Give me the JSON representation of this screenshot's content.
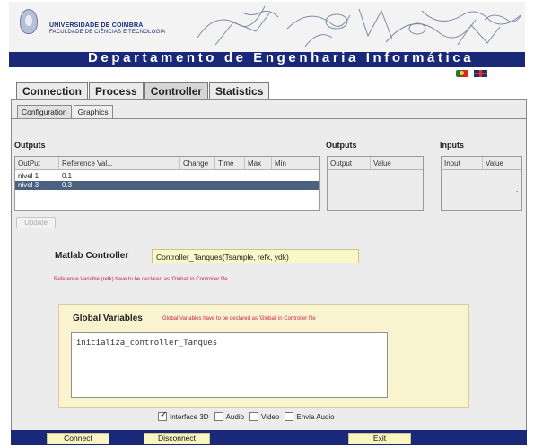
{
  "banner": {
    "university": "UNIVERSIDADE DE COIMBRA",
    "faculty": "FACULDADE DE CIÊNCIAS E TECNOLOGIA",
    "department": "Departamento de Engenharia Informática"
  },
  "main_tabs": [
    "Connection",
    "Process",
    "Controller",
    "Statistics"
  ],
  "sub_tabs": [
    "Configuration",
    "Graphics"
  ],
  "outputs_left": {
    "label": "Outputs",
    "columns": [
      "OutPut",
      "Reference Val...",
      "Change",
      "Time",
      "Max",
      "Min"
    ],
    "rows": [
      {
        "output": "nivel 1",
        "reference": "0.1",
        "selected": false
      },
      {
        "output": "nivel 3",
        "reference": "0.3",
        "selected": true
      }
    ]
  },
  "outputs_right": {
    "label": "Outputs",
    "columns": [
      "Output",
      "Value"
    ]
  },
  "inputs": {
    "label": "Inputs",
    "columns": [
      "Input",
      "Value"
    ],
    "dot": "."
  },
  "update_button": "Update",
  "matlab": {
    "label": "Matlab Controller",
    "value": "Controller_Tanques(Tsample, refk, ydk)",
    "note": "Reference Variable (refk) have to be declared as 'Global' in Controller file"
  },
  "global_vars": {
    "label": "Global Variables",
    "note": "Global Variables have to be declared as 'Global' in Controller file",
    "value": "inicializa_controller_Tanques"
  },
  "options": [
    {
      "label": "Interface 3D",
      "checked": true
    },
    {
      "label": "Audio",
      "checked": false
    },
    {
      "label": "Video",
      "checked": false
    },
    {
      "label": "Envia Audio",
      "checked": false
    }
  ],
  "buttons": {
    "connect": "Connect",
    "disconnect": "Disconnect",
    "exit": "Exit"
  },
  "colors": {
    "header_blue": "#1a287a",
    "selection": "#4a6180",
    "note_red": "#d2224f",
    "global_panel": "#f9f3cf",
    "field_yellow": "#fbf8c8"
  }
}
